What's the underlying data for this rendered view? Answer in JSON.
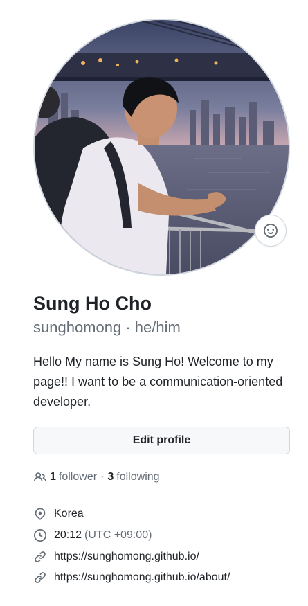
{
  "profile": {
    "avatar_alt": "Sung Ho Cho",
    "name": "Sung Ho Cho",
    "username": "sunghomong",
    "separator": "·",
    "pronouns": "he/him",
    "bio": "Hello My name is Sung Ho! Welcome to my page!! I want to be a communication-oriented developer.",
    "edit_label": "Edit profile"
  },
  "status_icon": "smiley-icon",
  "follow": {
    "followers_count": "1",
    "followers_label": "follower",
    "separator": "·",
    "following_count": "3",
    "following_label": "following"
  },
  "details": {
    "location": "Korea",
    "time": "20:12",
    "timezone": "(UTC +09:00)",
    "website": "https://sunghomong.github.io/",
    "link2": "https://sunghomong.github.io/about/"
  },
  "colors": {
    "text": "#1f2328",
    "muted": "#656d76",
    "border": "#d0d7de",
    "button_bg": "#f6f8fa"
  }
}
